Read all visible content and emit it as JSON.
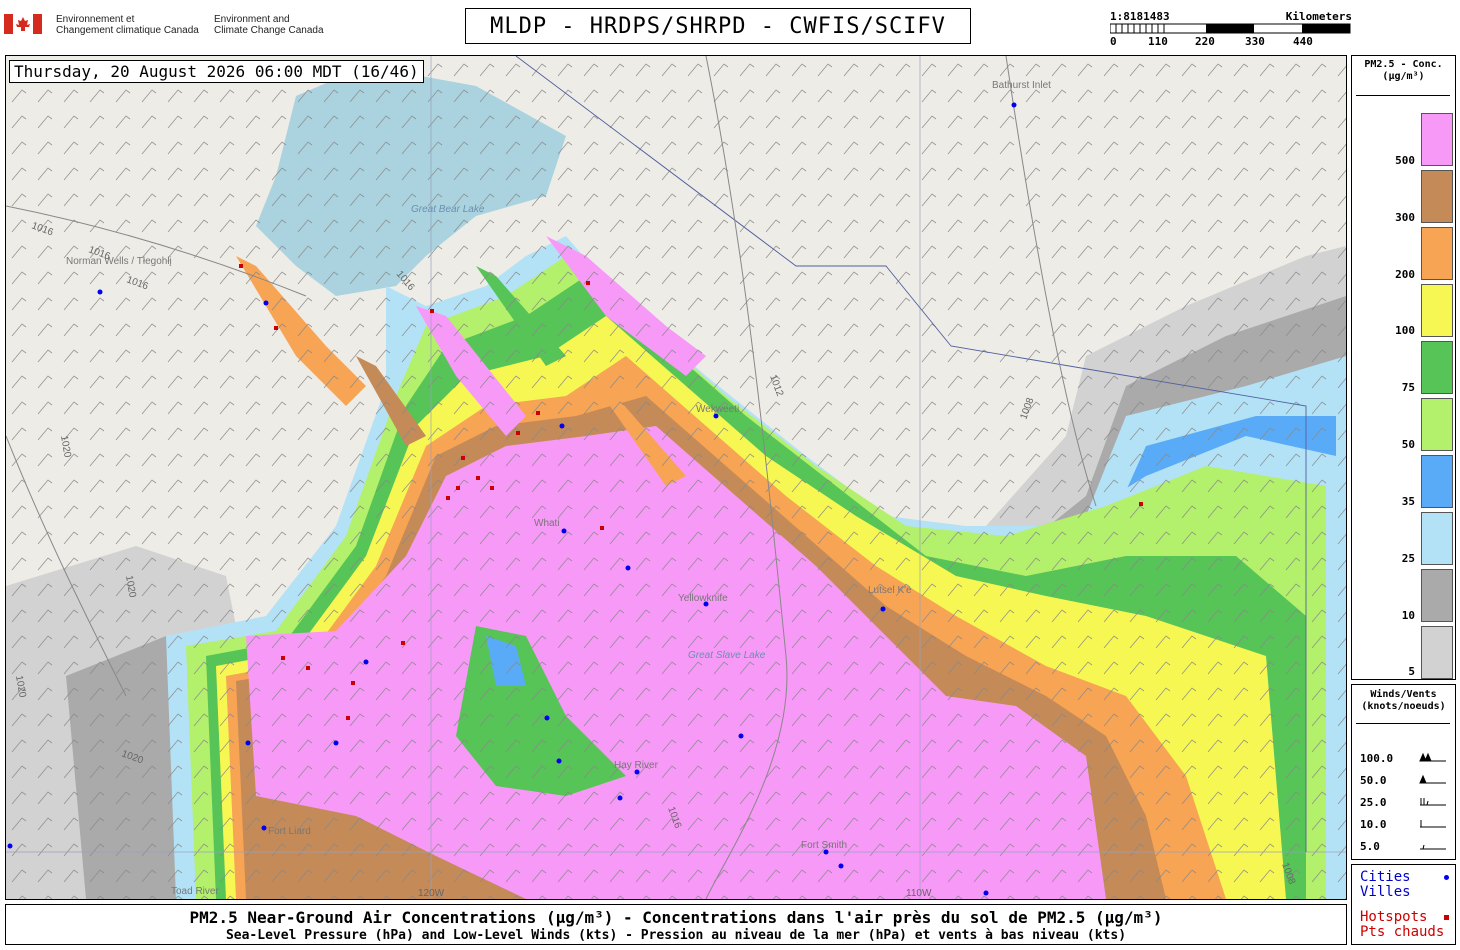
{
  "header": {
    "agency_fr": [
      "Environnement et",
      "Changement climatique Canada"
    ],
    "agency_en": [
      "Environment and",
      "Climate Change Canada"
    ],
    "title": "MLDP - HRDPS/SHRPD - CWFIS/SCIFV"
  },
  "scale_bar": {
    "ratio": "1:8181483",
    "unit": "Kilometers",
    "ticks": [
      "0",
      "110",
      "220",
      "330",
      "440"
    ]
  },
  "timestamp": "Thursday, 20 August 2026 06:00 MDT (16/46)",
  "legend_pm25": {
    "title": [
      "PM2.5 - Conc.",
      "(µg/m³)"
    ],
    "bins": [
      {
        "label": "500",
        "color": "#f799f7"
      },
      {
        "label": "300",
        "color": "#c48a57"
      },
      {
        "label": "200",
        "color": "#f7a454"
      },
      {
        "label": "100",
        "color": "#f7f754"
      },
      {
        "label": "75",
        "color": "#56c456"
      },
      {
        "label": "50",
        "color": "#b3f06b"
      },
      {
        "label": "35",
        "color": "#5aabf7"
      },
      {
        "label": "25",
        "color": "#b3e2f7"
      },
      {
        "label": "10",
        "color": "#aaaaaa"
      },
      {
        "label": "5",
        "color": "#d2d2d2"
      }
    ]
  },
  "legend_wind": {
    "title": [
      "Winds/Vents",
      "(knots/noeuds)"
    ],
    "rows": [
      "100.0",
      "50.0",
      "25.0",
      "10.0",
      "5.0"
    ]
  },
  "legend_points": {
    "cities": [
      "Cities",
      "Villes"
    ],
    "hotspots": [
      "Hotspots",
      "Pts chauds"
    ],
    "city_color": "#0000ee",
    "hotspot_color": "#cc0000"
  },
  "map": {
    "places": [
      "Bathurst Inlet",
      "Great Bear Lake",
      "Norman Wells / Tłegohłį",
      "Whati",
      "Yellowknife",
      "Great Slave Lake",
      "Hay River",
      "Fort Smith",
      "Lutsel K'e",
      "Wekweeti",
      "Toad River",
      "Fort Liard"
    ],
    "isobar_labels": [
      "1016",
      "1016",
      "1016",
      "1016",
      "1020",
      "1020",
      "1020",
      "1020",
      "1012",
      "1008",
      "1016",
      "1008"
    ],
    "meridians": [
      "120W",
      "110W"
    ]
  },
  "footer": {
    "line1": "PM2.5 Near-Ground Air Concentrations (µg/m³) - Concentrations dans l'air près du sol de PM2.5 (µg/m³)",
    "line2": "Sea-Level Pressure (hPa) and Low-Level Winds (kts) - Pression au niveau de la mer (hPa) et vents à bas niveau (kts)"
  }
}
